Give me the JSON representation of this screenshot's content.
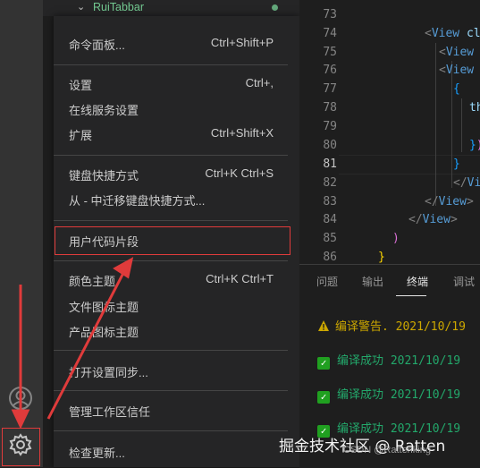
{
  "explorer": {
    "folder": "RuiTabbar",
    "chevron": "chevron-down-icon"
  },
  "menu": {
    "items": [
      {
        "label": "命令面板...",
        "shortcut": "Ctrl+Shift+P"
      },
      {
        "label": "设置",
        "shortcut": "Ctrl+,"
      },
      {
        "label": "在线服务设置",
        "shortcut": ""
      },
      {
        "label": "扩展",
        "shortcut": "Ctrl+Shift+X"
      },
      {
        "label": "键盘快捷方式",
        "shortcut": "Ctrl+K Ctrl+S"
      },
      {
        "label": "从 - 中迁移键盘快捷方式...",
        "shortcut": ""
      },
      {
        "label": "用户代码片段",
        "shortcut": ""
      },
      {
        "label": "颜色主题",
        "shortcut": "Ctrl+K Ctrl+T"
      },
      {
        "label": "文件图标主题",
        "shortcut": ""
      },
      {
        "label": "产品图标主题",
        "shortcut": ""
      },
      {
        "label": "打开设置同步...",
        "shortcut": ""
      },
      {
        "label": "管理工作区信任",
        "shortcut": ""
      },
      {
        "label": "检查更新...",
        "shortcut": ""
      }
    ]
  },
  "editor": {
    "line_numbers": [
      "73",
      "74",
      "75",
      "76",
      "77",
      "78",
      "79",
      "80",
      "81",
      "82",
      "83",
      "84",
      "85",
      "86"
    ],
    "active_line": "81",
    "code": {
      "l74_open": "<",
      "l74_tag": "View",
      "l74_attr": " cl",
      "l75_open": "<",
      "l75_tag": "View",
      "l76_open": "<",
      "l76_tag": "View",
      "l77": "{",
      "l78": "th",
      "l80_brace": "}",
      "l80_paren": ")",
      "l81": "}",
      "l82_open": "</",
      "l82_tag": "View",
      "l83_open": "</",
      "l83_tag": "View",
      "l83_close": ">",
      "l84_open": "</",
      "l84_tag": "View",
      "l84_close": ">",
      "l85": ")",
      "l86": "}"
    }
  },
  "panel": {
    "tabs": [
      "问题",
      "输出",
      "终端",
      "调试"
    ],
    "active_tab": "终端",
    "lines": [
      {
        "type": "warning",
        "text": "编译警告. 2021/10/19"
      },
      {
        "type": "success",
        "text": "编译成功  2021/10/19"
      },
      {
        "type": "success",
        "text": "编译成功  2021/10/19"
      },
      {
        "type": "success",
        "text": "编译成功  2021/10/19"
      }
    ]
  },
  "activity_bar": {
    "icons": [
      "account-icon",
      "gear-icon"
    ]
  },
  "watermark": {
    "main": "掘金技术社区 @ Ratten",
    "sub": "CSDN @Rattenking"
  },
  "colors": {
    "highlight_box": "#e03b3b",
    "menu_bg": "#252526",
    "editor_bg": "#1e1e1e",
    "activity_bg": "#333333"
  }
}
